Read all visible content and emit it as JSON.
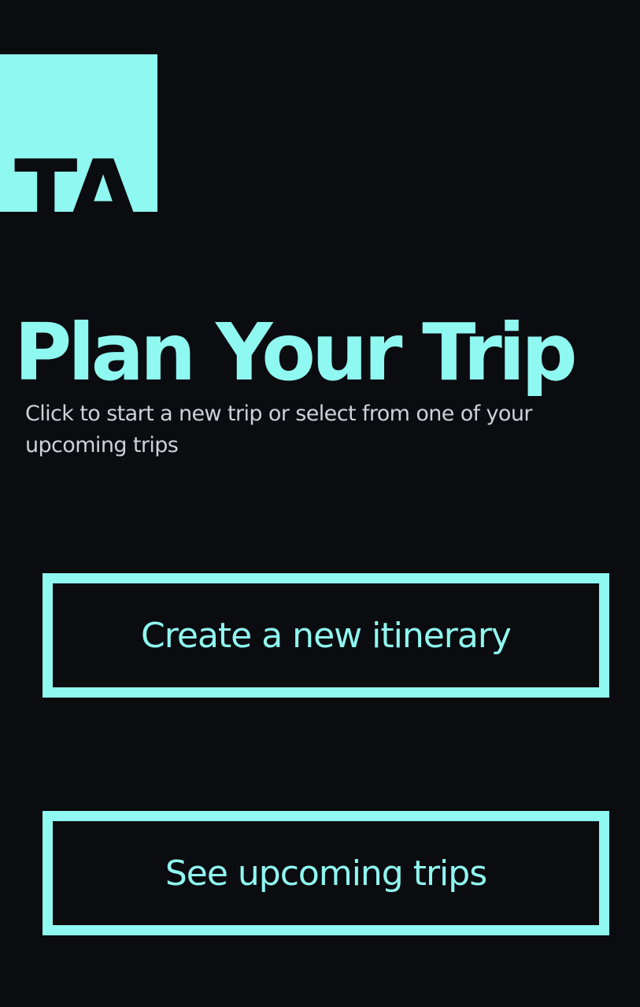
{
  "logo": {
    "text": "TA"
  },
  "header": {
    "title": "Plan Your Trip",
    "subtitle": "Click to start a new trip or select from one of your upcoming trips"
  },
  "actions": {
    "create_label": "Create a new itinerary",
    "upcoming_label": "See upcoming trips"
  },
  "colors": {
    "background": "#0b0c10",
    "accent": "#8ff8f0",
    "subtitle_text": "#cfd1d6"
  }
}
